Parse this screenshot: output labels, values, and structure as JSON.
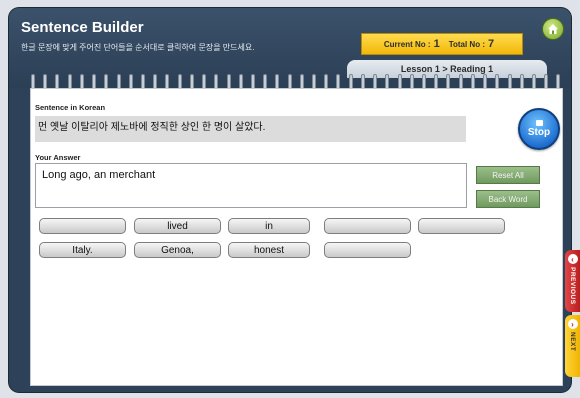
{
  "header": {
    "title": "Sentence Builder",
    "subtitle": "한글 문장에 맞게 주어진 단어들을 순서대로 클릭하여 문장을 만드세요.",
    "home_icon": "home-icon",
    "counter": {
      "current_label": "Current No :",
      "current_value": "1",
      "total_label": "Total No :",
      "total_value": "7"
    },
    "lesson_tab": "Lesson 1 > Reading 1"
  },
  "main": {
    "korean_label": "Sentence in Korean",
    "korean_text": "먼 옛날 이탈리아 제노바에 정직한 상인 한 명이 살았다.",
    "answer_label": "Your Answer",
    "answer_text": "Long ago, an merchant",
    "stop_label": "Stop",
    "reset_label": "Reset All",
    "back_label": "Back Word"
  },
  "word_chips": [
    {
      "label": ""
    },
    {
      "label": "lived"
    },
    {
      "label": "in"
    },
    {
      "label": ""
    },
    {
      "label": ""
    },
    {
      "label": "Italy."
    },
    {
      "label": "Genoa,"
    },
    {
      "label": "honest"
    },
    {
      "label": ""
    }
  ],
  "side_tabs": {
    "previous": "PREVIOUS",
    "next": "NEXT"
  },
  "colors": {
    "frame": "#2d4258",
    "counter_bg": "#f5c518",
    "stop_button": "#1f6fd0",
    "action_button": "#7fa66d",
    "previous_tab": "#d32f2f",
    "next_tab": "#f5c518"
  }
}
